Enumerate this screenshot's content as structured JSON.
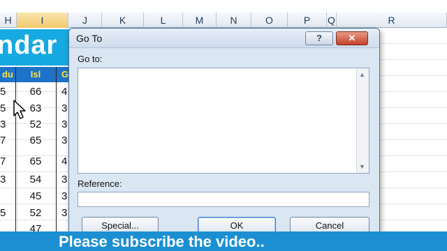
{
  "sheet": {
    "columns": [
      {
        "letter": "H",
        "selected": false
      },
      {
        "letter": "I",
        "selected": true
      },
      {
        "letter": "J",
        "selected": false
      },
      {
        "letter": "K",
        "selected": false
      },
      {
        "letter": "L",
        "selected": false
      },
      {
        "letter": "M",
        "selected": false
      },
      {
        "letter": "N",
        "selected": false
      },
      {
        "letter": "O",
        "selected": false
      },
      {
        "letter": "P",
        "selected": false
      },
      {
        "letter": "Q",
        "selected": false
      },
      {
        "letter": "R",
        "selected": false
      }
    ],
    "title_fragment": "ndar",
    "headers": [
      "du",
      "Isl",
      "G"
    ],
    "rows": [
      {
        "col1": "5",
        "col2": "66",
        "col3": "4"
      },
      {
        "col1": "5",
        "col2": "63",
        "col3": "3"
      },
      {
        "col1": "3",
        "col2": "52",
        "col3": "3"
      },
      {
        "col1": "7",
        "col2": "65",
        "col3": "3"
      },
      {
        "col1": "7",
        "col2": "65",
        "col3": "4"
      },
      {
        "col1": "3",
        "col2": "54",
        "col3": "3"
      },
      {
        "col1": "",
        "col2": "45",
        "col3": "3"
      },
      {
        "col1": "5",
        "col2": "52",
        "col3": "3"
      },
      {
        "col1": "",
        "col2": "47",
        "col3": ""
      }
    ],
    "colors": {
      "title_band": "#17a9e1",
      "header_band": "#1e73c8",
      "header_text": "#ffe23b"
    }
  },
  "dialog": {
    "title": "Go To",
    "help_label": "?",
    "close_label": "✕",
    "goto_label": "Go to:",
    "reference_label": "Reference:",
    "reference_value": "",
    "buttons": {
      "special": "Special...",
      "ok": "OK",
      "cancel": "Cancel"
    }
  },
  "banner": {
    "text": "Please subscribe the video..",
    "color": "#1b8fd1"
  }
}
